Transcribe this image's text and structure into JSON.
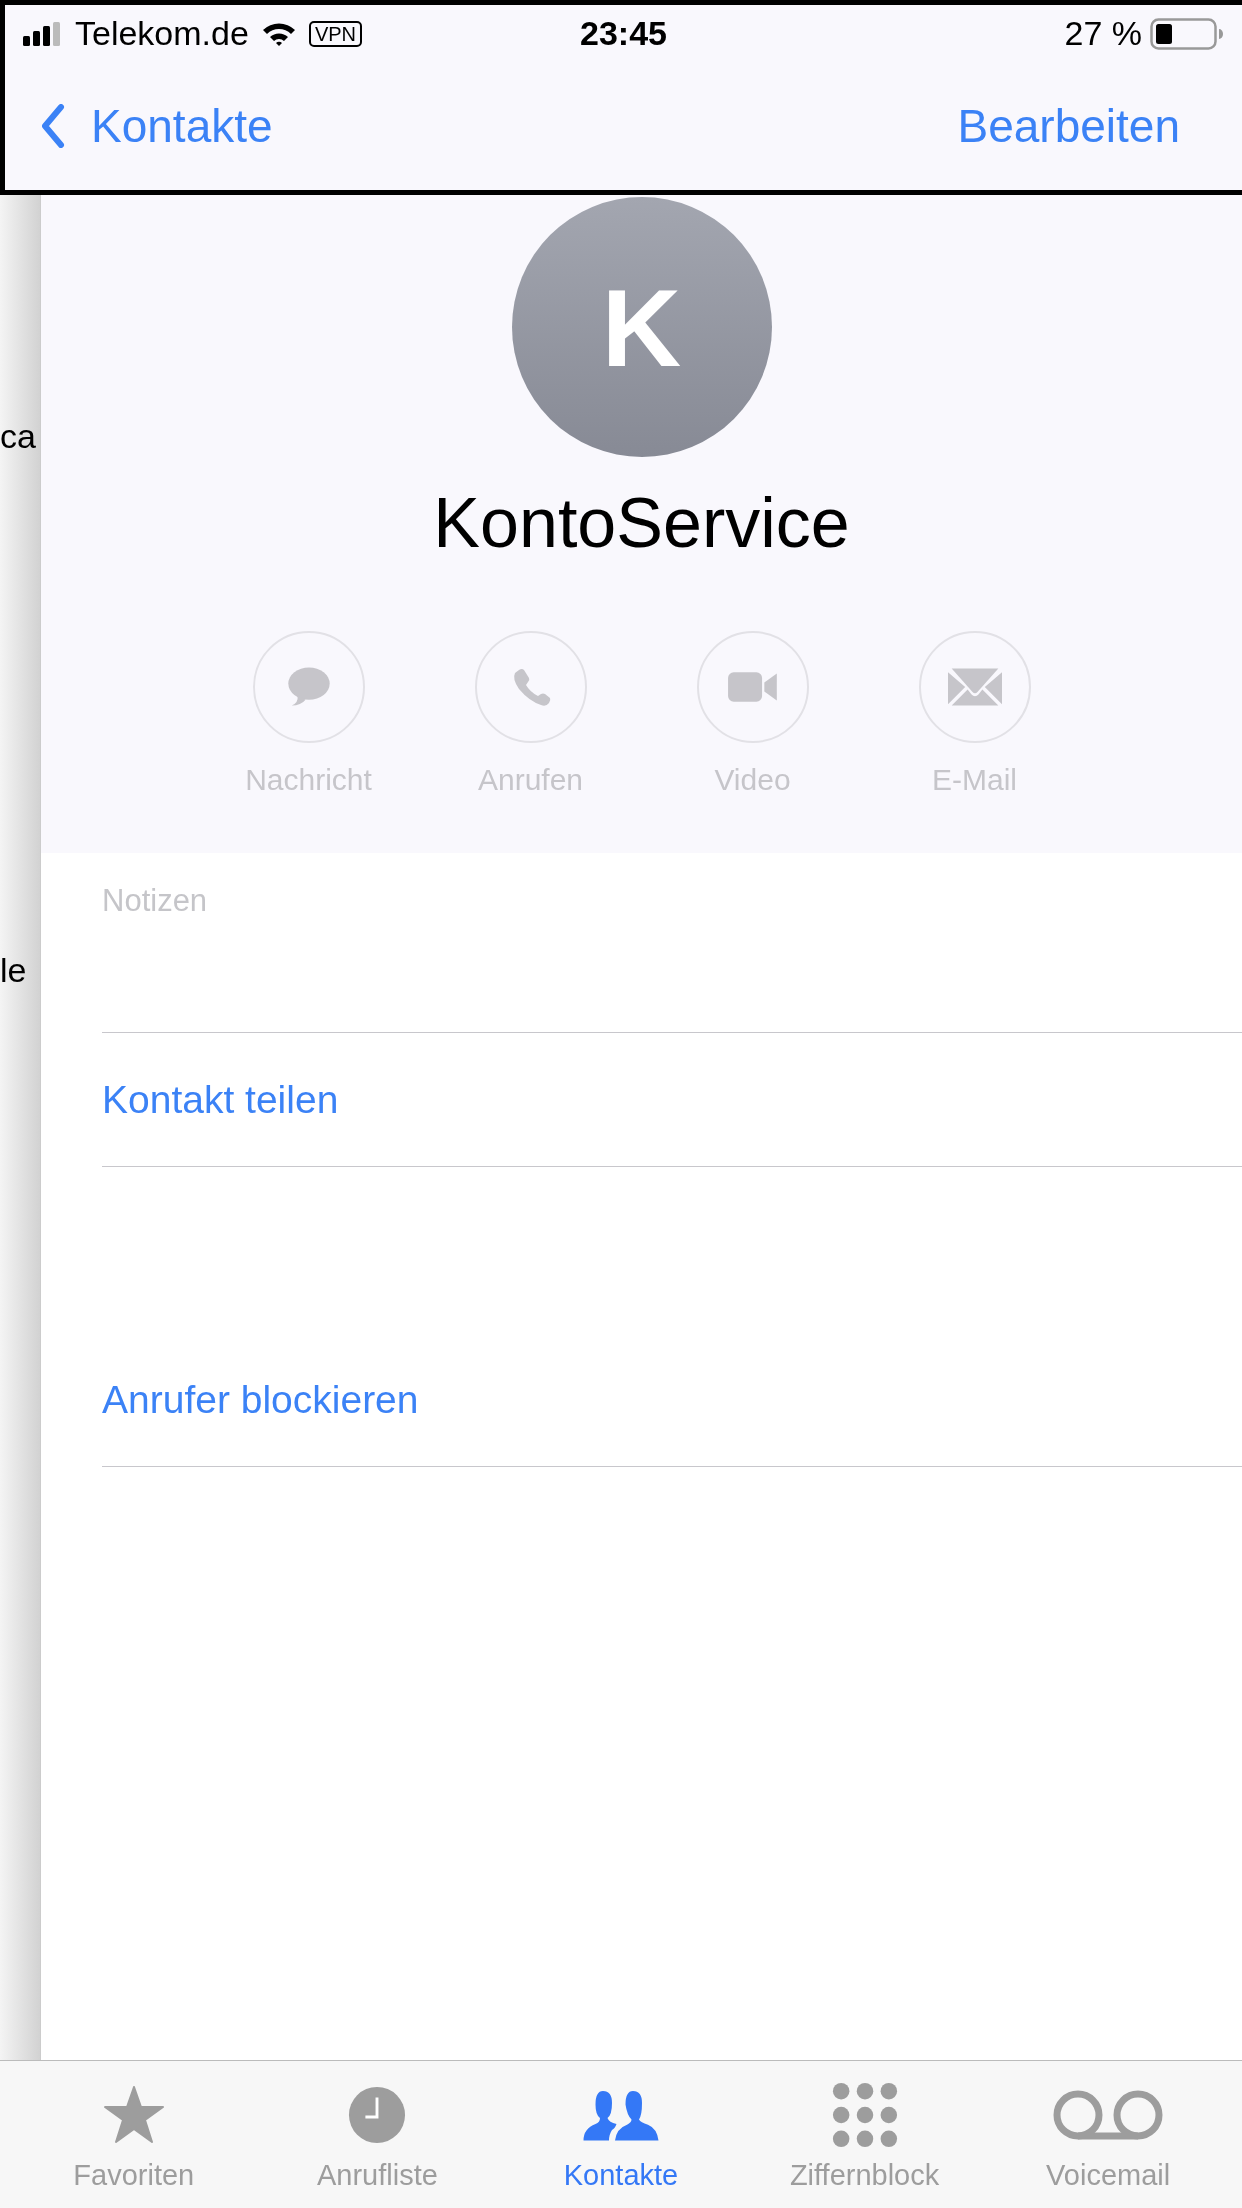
{
  "status_bar": {
    "carrier": "Telekom.de",
    "vpn": "VPN",
    "time": "23:45",
    "battery": "27 %"
  },
  "nav": {
    "back": "Kontakte",
    "action": "Bearbeiten"
  },
  "underlay": {
    "fragments": [
      "ca",
      "le"
    ]
  },
  "contact": {
    "initial": "K",
    "name": "KontoService"
  },
  "actions": [
    {
      "label": "Nachricht",
      "kind": "message",
      "disabled": true
    },
    {
      "label": "Anrufen",
      "kind": "call",
      "disabled": true
    },
    {
      "label": "Video",
      "kind": "video",
      "disabled": true
    },
    {
      "label": "E-Mail",
      "kind": "mail",
      "disabled": true
    }
  ],
  "notes": {
    "label": "Notizen"
  },
  "links": [
    {
      "label": "Kontakt teilen"
    },
    {
      "label": "Anrufer blockieren"
    }
  ],
  "tabs": [
    {
      "label": "Favoriten",
      "kind": "favorites",
      "selected": false
    },
    {
      "label": "Anrufliste",
      "kind": "recents",
      "selected": false
    },
    {
      "label": "Kontakte",
      "kind": "contacts",
      "selected": true
    },
    {
      "label": "Ziffernblock",
      "kind": "keypad",
      "selected": false
    },
    {
      "label": "Voicemail",
      "kind": "voicemail",
      "selected": false
    }
  ]
}
